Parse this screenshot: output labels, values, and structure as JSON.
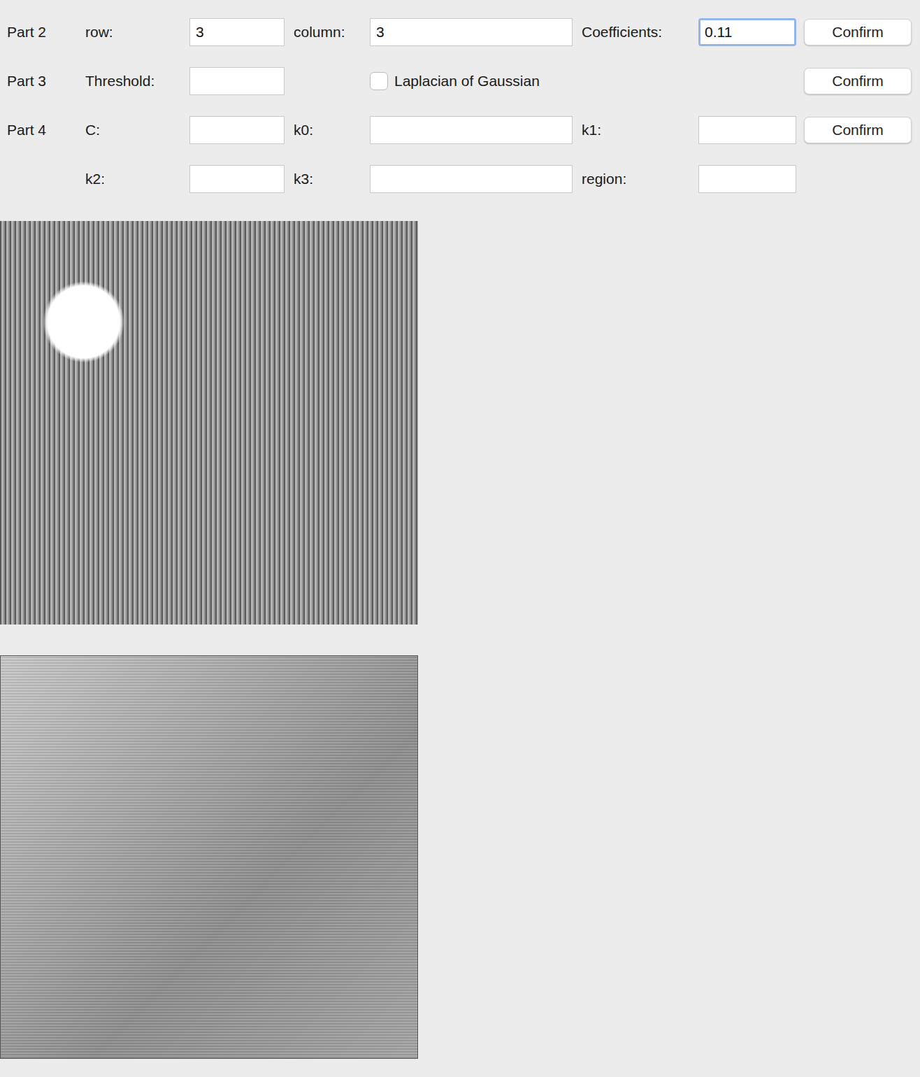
{
  "rows": [
    {
      "part": "Part 2",
      "items": [
        {
          "kind": "field",
          "label": "row:",
          "value": "3",
          "focused": false
        },
        {
          "kind": "field",
          "label": "column:",
          "value": "3",
          "focused": false
        },
        {
          "kind": "field",
          "label": "Coefficients:",
          "value": "0.11",
          "focused": true
        }
      ],
      "button": "Confirm"
    },
    {
      "part": "Part 3",
      "items": [
        {
          "kind": "field",
          "label": "Threshold:",
          "value": "",
          "focused": false
        },
        {
          "kind": "checkbox",
          "label": "Laplacian of Gaussian",
          "checked": false
        }
      ],
      "button": "Confirm"
    },
    {
      "part": "Part 4",
      "items": [
        {
          "kind": "field",
          "label": "C:",
          "value": "",
          "focused": false
        },
        {
          "kind": "field",
          "label": "k0:",
          "value": "",
          "focused": false
        },
        {
          "kind": "field",
          "label": "k1:",
          "value": "",
          "focused": false
        }
      ],
      "button": "Confirm"
    },
    {
      "part": "",
      "items": [
        {
          "kind": "field",
          "label": "k2:",
          "value": "",
          "focused": false
        },
        {
          "kind": "field",
          "label": "k3:",
          "value": "",
          "focused": false
        },
        {
          "kind": "field",
          "label": "region:",
          "value": "",
          "focused": false
        }
      ],
      "button": ""
    }
  ]
}
